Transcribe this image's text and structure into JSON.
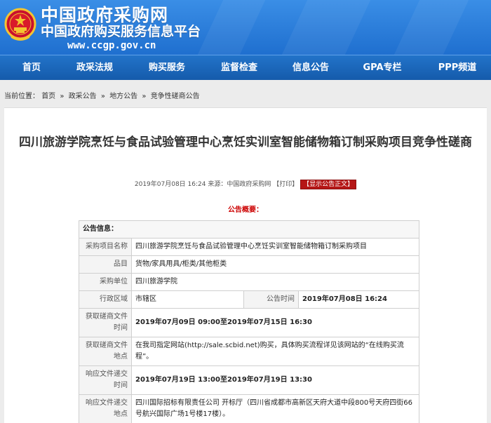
{
  "header": {
    "site_name": "中国政府采购网",
    "site_subtitle": "中国政府购买服务信息平台",
    "url": "www.ccgp.gov.cn",
    "emblem_icon": "national-emblem-icon",
    "brand_color": "#1f6fcf"
  },
  "nav": {
    "items": [
      {
        "label": "首页"
      },
      {
        "label": "政采法规"
      },
      {
        "label": "购买服务"
      },
      {
        "label": "监督检查"
      },
      {
        "label": "信息公告"
      },
      {
        "label": "GPA专栏"
      },
      {
        "label": "PPP频道"
      }
    ]
  },
  "breadcrumb": {
    "prefix": "当前位置：",
    "items": [
      "首页",
      "政采公告",
      "地方公告",
      "竞争性磋商公告"
    ],
    "separator": "»"
  },
  "article": {
    "title": "四川旅游学院烹饪与食品试验管理中心烹饪实训室智能储物箱订制采购项目竞争性磋商",
    "meta": "2019年07月08日 16:24 来源：中国政府采购网 【打印】",
    "show_body_label": "【显示公告正文】",
    "summary_label": "公告概要：",
    "accent_color": "#c00000"
  },
  "info_table": {
    "section_label": "公告信息：",
    "rows": {
      "project_name": {
        "label": "采购项目名称",
        "value": "四川旅游学院烹饪与食品试验管理中心烹饪实训室智能储物箱订制采购项目"
      },
      "category": {
        "label": "品目",
        "value": "货物/家具用具/柜类/其他柜类"
      },
      "purchaser": {
        "label": "采购单位",
        "value": "四川旅游学院"
      },
      "region": {
        "label": "行政区域",
        "value": "市辖区"
      },
      "publish_time": {
        "label": "公告时间",
        "value": "2019年07月08日 16:24"
      },
      "obtain_time": {
        "label": "获取磋商文件时间",
        "value": "2019年07月09日 09:00至2019年07月15日 16:30"
      },
      "obtain_place": {
        "label": "获取磋商文件地点",
        "value": "在我司指定网站(http://sale.scbid.net)购买，具体购买流程详见该网站的“在线购买流程”。"
      },
      "submit_time": {
        "label": "响应文件递交时间",
        "value": "2019年07月19日 13:00至2019年07月19日 13:30"
      },
      "submit_place": {
        "label": "响应文件递交地点",
        "value": "四川国际招标有限责任公司 开标厅（四川省成都市高新区天府大道中段800号天府四街66号航兴国际广场1号楼17楼）。"
      }
    }
  }
}
